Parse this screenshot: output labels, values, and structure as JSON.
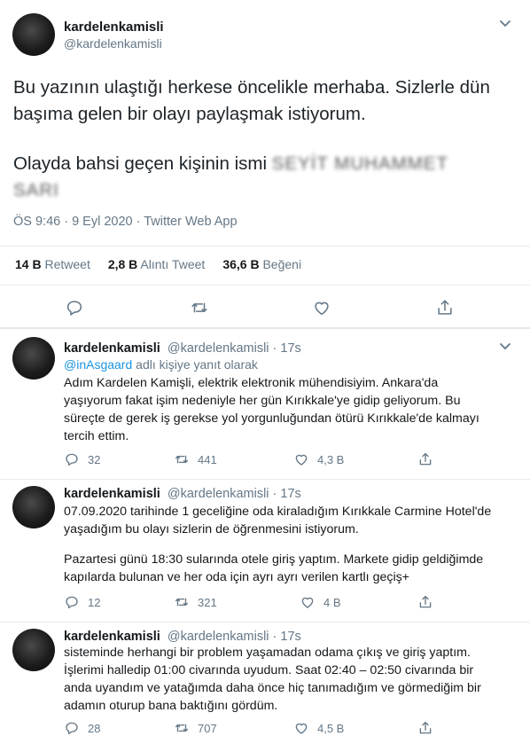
{
  "main_tweet": {
    "name": "kardelenkamisli",
    "handle": "@kardelenkamisli",
    "para1": "Bu yazının ulaştığı herkese öncelikle merhaba. Sizlerle dün başıma gelen bir olayı paylaşmak istiyorum.",
    "para2_prefix": "Olayda bahsi geçen kişinin ismi",
    "redacted_1": "SEYİT MUHAMMET",
    "redacted_2": "SARI",
    "meta": "ÖS 9:46 · 9 Eyl 2020 · Twitter Web App",
    "stats": {
      "retweets_count": "14 B",
      "retweets_label": "Retweet",
      "quotes_count": "2,8 B",
      "quotes_label": "Alıntı Tweet",
      "likes_count": "36,6 B",
      "likes_label": "Beğeni"
    }
  },
  "replies": [
    {
      "name": "kardelenkamisli",
      "handle_time": "@kardelenkamisli · 17s",
      "reply_prefix_link": "@inAsgaard",
      "reply_prefix_rest": "adlı kişiye yanıt olarak",
      "lines": [
        "Adım Kardelen Kamişli, elektrik elektronik mühendisiyim. Ankara'da",
        "yaşıyorum fakat işim nedeniyle her gün Kırıkkale'ye gidip geliyorum. Bu",
        "süreçte de gerek iş gerekse yol yorgunluğundan ötürü Kırıkkale'de kalmayı",
        "tercih ettim."
      ],
      "replies_count": "32",
      "retweets_count": "441",
      "likes_count": "4,3 B"
    },
    {
      "name": "kardelenkamisli",
      "handle_time": "@kardelenkamisli · 17s",
      "lines": [
        "07.09.2020 tarihinde 1 geceliğine oda kiraladığım Kırıkkale Carmine Hotel'de",
        "yaşadığım bu olayı sizlerin de öğrenmesini istiyorum.",
        "",
        "Pazartesi günü 18:30 sularında otele giriş yaptım. Markete gidip geldiğimde",
        "kapılarda bulunan ve her oda için ayrı ayrı verilen kartlı geçiş+"
      ],
      "replies_count": "12",
      "retweets_count": "321",
      "likes_count": "4 B"
    },
    {
      "name": "kardelenkamisli",
      "handle_time": "@kardelenkamisli · 17s",
      "lines": [
        "sisteminde herhangi bir problem yaşamadan odama çıkış ve giriş yaptım.",
        "İşlerimi halledip 01:00 civarında uyudum. Saat 02:40 – 02:50 civarında bir",
        "anda uyandım ve yatağımda daha önce hiç tanımadığım ve görmediğim bir",
        "adamın oturup bana baktığını gördüm."
      ],
      "replies_count": "28",
      "retweets_count": "707",
      "likes_count": "4,5 B"
    }
  ]
}
